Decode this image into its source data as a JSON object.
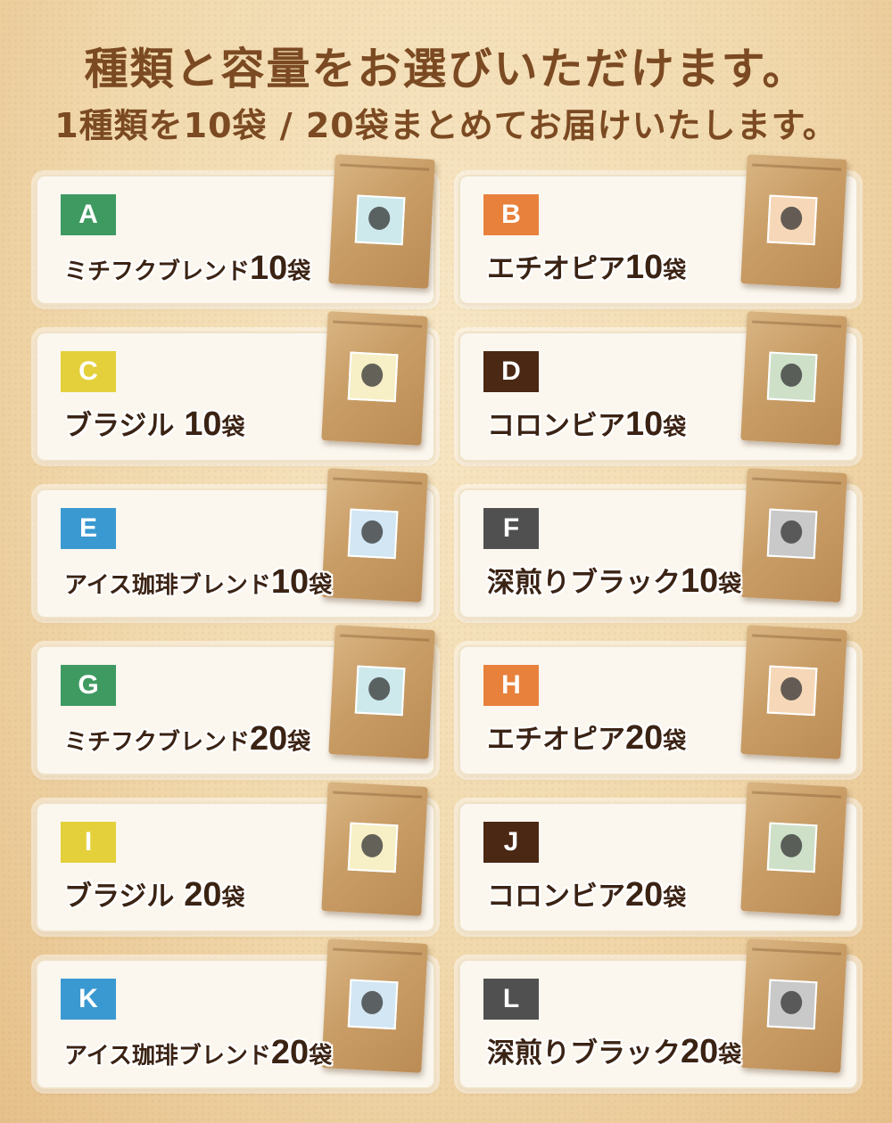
{
  "header": {
    "line1": "種類と容量をお選びいただけます。",
    "line2": "1種類を10袋 / 20袋まとめてお届けいたします。"
  },
  "unit": "袋",
  "products": [
    {
      "letter": "A",
      "name": "ミチフクブレンド",
      "count": "10",
      "badge_color": "#3f9a62",
      "label_color": "#cde9ec"
    },
    {
      "letter": "B",
      "name": "エチオピア",
      "count": "10",
      "badge_color": "#e8813c",
      "label_color": "#f6d8b8"
    },
    {
      "letter": "C",
      "name": "ブラジル ",
      "count": "10",
      "badge_color": "#e4d03a",
      "label_color": "#f7efc6"
    },
    {
      "letter": "D",
      "name": "コロンビア",
      "count": "10",
      "badge_color": "#4a2814",
      "label_color": "#cfe0c9"
    },
    {
      "letter": "E",
      "name": "アイス珈琲ブレンド",
      "count": "10",
      "badge_color": "#3b99d1",
      "label_color": "#d2e6f3"
    },
    {
      "letter": "F",
      "name": "深煎りブラック",
      "count": "10",
      "badge_color": "#505050",
      "label_color": "#c9c9c9"
    },
    {
      "letter": "G",
      "name": "ミチフクブレンド",
      "count": "20",
      "badge_color": "#3f9a62",
      "label_color": "#cde9ec"
    },
    {
      "letter": "H",
      "name": "エチオピア",
      "count": "20",
      "badge_color": "#e8813c",
      "label_color": "#f6d8b8"
    },
    {
      "letter": "I",
      "name": "ブラジル ",
      "count": "20",
      "badge_color": "#e4d03a",
      "label_color": "#f7efc6"
    },
    {
      "letter": "J",
      "name": "コロンビア",
      "count": "20",
      "badge_color": "#4a2814",
      "label_color": "#cfe0c9"
    },
    {
      "letter": "K",
      "name": "アイス珈琲ブレンド",
      "count": "20",
      "badge_color": "#3b99d1",
      "label_color": "#d2e6f3"
    },
    {
      "letter": "L",
      "name": "深煎りブラック",
      "count": "20",
      "badge_color": "#505050",
      "label_color": "#c9c9c9"
    }
  ]
}
